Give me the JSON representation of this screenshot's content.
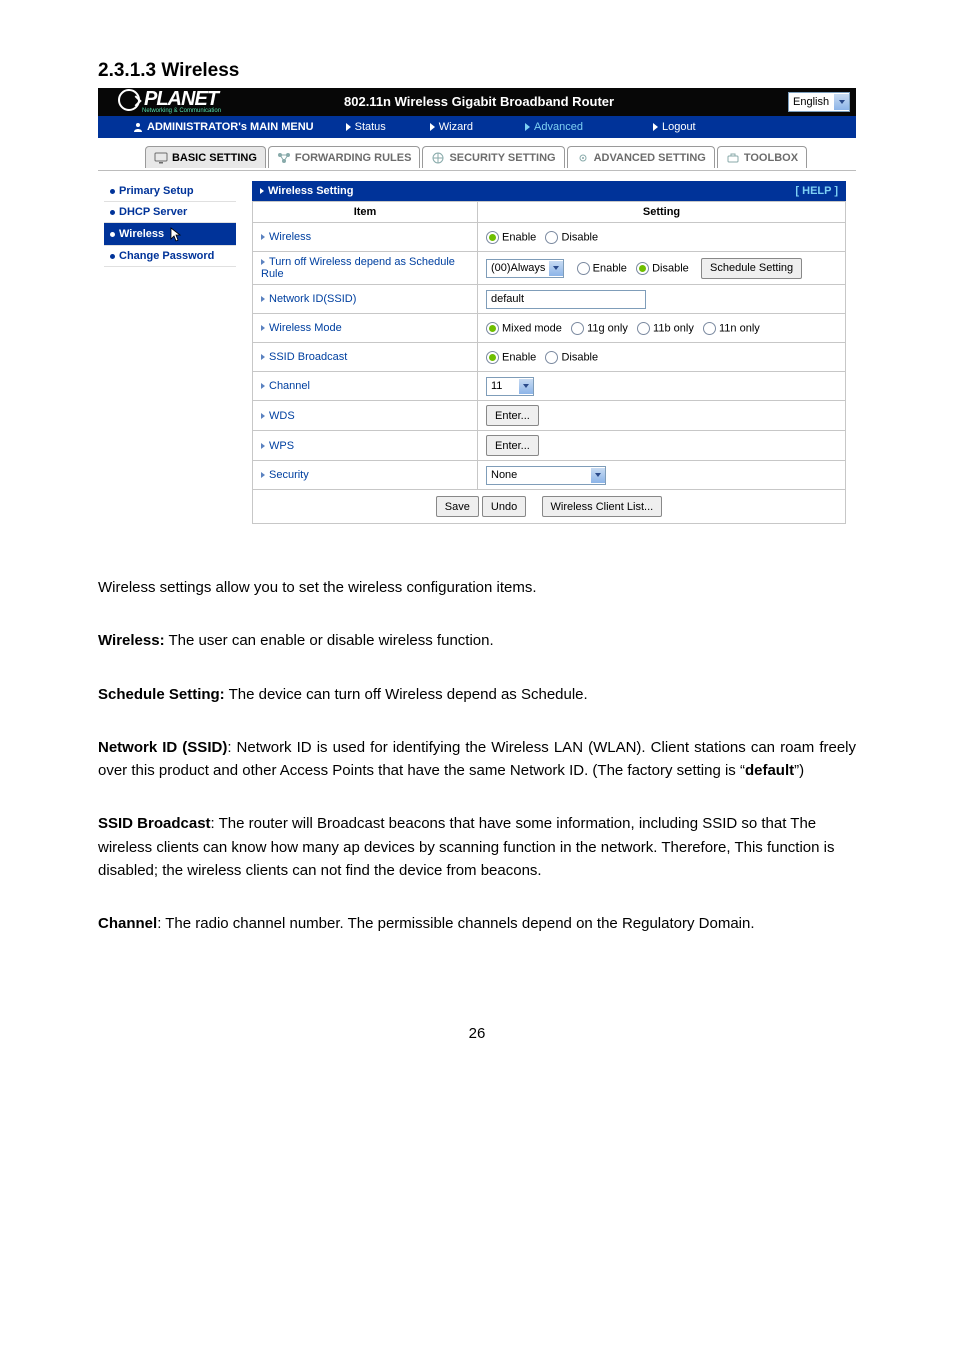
{
  "heading": "2.3.1.3 Wireless",
  "router": {
    "brand": "PLANET",
    "brand_sub": "Networking & Communication",
    "title": "802.11n Wireless Gigabit Broadband Router",
    "language": "English",
    "nav": {
      "main_label": "ADMINISTRATOR's MAIN MENU",
      "items": {
        "status": "Status",
        "wizard": "Wizard",
        "advanced": "Advanced",
        "logout": "Logout"
      }
    },
    "tabs": {
      "basic": "BASIC SETTING",
      "forwarding": "FORWARDING RULES",
      "security": "SECURITY SETTING",
      "advanced": "ADVANCED SETTING",
      "toolbox": "TOOLBOX"
    },
    "sidebar": {
      "primary": "Primary Setup",
      "dhcp": "DHCP Server",
      "wireless": "Wireless",
      "change_pw": "Change Password"
    },
    "panel": {
      "title": "Wireless Setting",
      "help": "[ HELP ]",
      "th_item": "Item",
      "th_setting": "Setting",
      "rows": {
        "wireless": {
          "label": "Wireless",
          "enable": "Enable",
          "disable": "Disable"
        },
        "schedule": {
          "label": "Turn off Wireless depend as Schedule Rule",
          "select": "(00)Always",
          "enable": "Enable",
          "disable": "Disable",
          "btn": "Schedule Setting"
        },
        "ssid": {
          "label": "Network ID(SSID)",
          "value": "default"
        },
        "mode": {
          "label": "Wireless Mode",
          "opts": {
            "mixed": "Mixed mode",
            "g": "11g only",
            "b": "11b only",
            "n": "11n only"
          }
        },
        "broadcast": {
          "label": "SSID Broadcast",
          "enable": "Enable",
          "disable": "Disable"
        },
        "channel": {
          "label": "Channel",
          "value": "11"
        },
        "wds": {
          "label": "WDS",
          "btn": "Enter..."
        },
        "wps": {
          "label": "WPS",
          "btn": "Enter..."
        },
        "security": {
          "label": "Security",
          "value": "None"
        }
      },
      "buttons": {
        "save": "Save",
        "undo": "Undo",
        "clients": "Wireless Client List..."
      }
    }
  },
  "body": {
    "intro": "Wireless settings allow you to set the wireless configuration items.",
    "p_wireless_label": "Wireless:",
    "p_wireless_text": " The user can enable or disable wireless function.",
    "p_sched_label": "Schedule Setting:",
    "p_sched_text": " The device can turn off Wireless depend as Schedule.",
    "p_ssid_label": "Network ID (SSID)",
    "p_ssid_text_a": ": Network ID is used for identifying the Wireless LAN (WLAN). Client stations can roam freely over this product and other Access Points that have the same Network ID. (The factory setting is “",
    "p_ssid_default": "default",
    "p_ssid_text_b": "”)",
    "p_bcast_label": "SSID Broadcast",
    "p_bcast_text": ": The router will Broadcast beacons that have some information, including SSID so that The wireless clients can know how many ap devices by scanning function in the network. Therefore, This function is disabled; the wireless clients can not find the device from beacons.",
    "p_channel_label": "Channel",
    "p_channel_text": ": The radio channel number. The permissible channels depend on the Regulatory Domain."
  },
  "page_number": "26"
}
